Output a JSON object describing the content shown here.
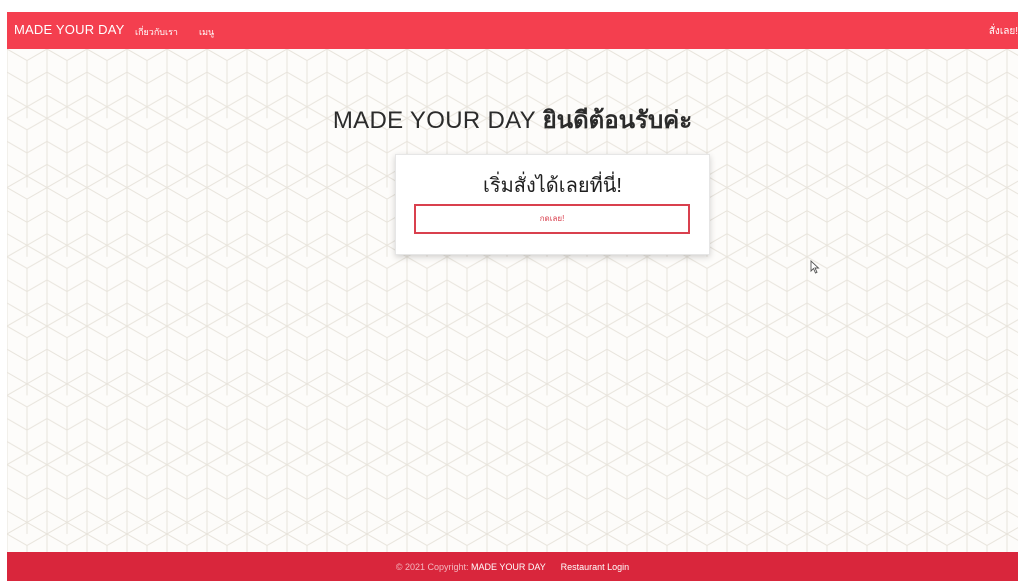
{
  "navbar": {
    "brand": "MADE YOUR DAY",
    "links": [
      "เกี่ยวกับเรา",
      "เมนู"
    ],
    "order_label": "สั่งเลย!",
    "color": "#f43f4f"
  },
  "hero": {
    "title_prefix": "MADE YOUR DAY",
    "title_suffix": "ยินดีต้อนรับค่ะ"
  },
  "card": {
    "title": "เริ่มสั่งได้เลยที่นี่!",
    "button_label": "กดเลย!"
  },
  "footer": {
    "copyright": "© 2021 Copyright:",
    "brand": "MADE YOUR DAY",
    "restaurant_login": "Restaurant Login",
    "color": "#d9263c"
  }
}
